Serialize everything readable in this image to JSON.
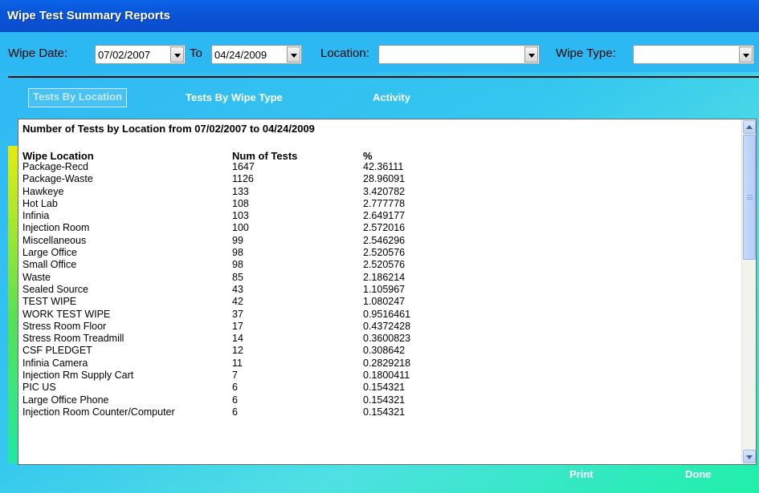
{
  "window": {
    "title": "Wipe Test Summary Reports"
  },
  "filters": {
    "wipe_date_label": "Wipe Date:",
    "from_date": "07/02/2007",
    "to_label": "To",
    "to_date": "04/24/2009",
    "location_label": "Location:",
    "location_value": "",
    "wipe_type_label": "Wipe Type:",
    "wipe_type_value": ""
  },
  "tabs": [
    {
      "label": "Tests By Location",
      "active": true
    },
    {
      "label": "Tests By Wipe Type",
      "active": false
    },
    {
      "label": "Activity",
      "active": false
    }
  ],
  "report": {
    "title": "Number of Tests by Location from 07/02/2007 to 04/24/2009",
    "columns": [
      "Wipe Location",
      "Num of Tests",
      "%"
    ],
    "rows": [
      [
        "Package-Recd",
        "1647",
        "42.36111"
      ],
      [
        "Package-Waste",
        "1126",
        "28.96091"
      ],
      [
        "Hawkeye",
        "133",
        "3.420782"
      ],
      [
        "Hot Lab",
        "108",
        "2.777778"
      ],
      [
        "Infinia",
        "103",
        "2.649177"
      ],
      [
        "Injection Room",
        "100",
        "2.572016"
      ],
      [
        "Miscellaneous",
        "99",
        "2.546296"
      ],
      [
        "Large Office",
        "98",
        "2.520576"
      ],
      [
        "Small Office",
        "98",
        "2.520576"
      ],
      [
        "Waste",
        "85",
        "2.186214"
      ],
      [
        "Sealed Source",
        "43",
        "1.105967"
      ],
      [
        "TEST WIPE",
        "42",
        "1.080247"
      ],
      [
        "WORK TEST WIPE",
        "37",
        "0.9516461"
      ],
      [
        "Stress Room Floor",
        "17",
        "0.4372428"
      ],
      [
        "Stress Room Treadmill",
        "14",
        "0.3600823"
      ],
      [
        "CSF PLEDGET",
        "12",
        "0.308642"
      ],
      [
        "Infinia Camera",
        "11",
        "0.2829218"
      ],
      [
        "Injection Rm Supply Cart",
        "7",
        "0.1800411"
      ],
      [
        "PIC US",
        "6",
        "0.154321"
      ],
      [
        "Large Office Phone",
        "6",
        "0.154321"
      ],
      [
        "Injection Room Counter/Computer",
        "6",
        "0.154321"
      ]
    ]
  },
  "actions": {
    "print_label": "Print",
    "done_label": "Done"
  }
}
